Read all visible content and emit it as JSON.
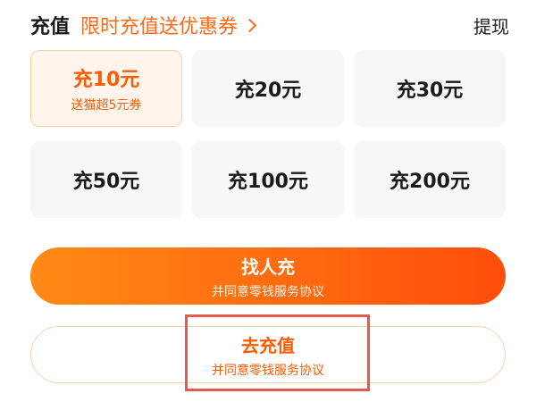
{
  "header": {
    "title": "充值",
    "promo_text": "限时充值送优惠券",
    "withdraw_label": "提现"
  },
  "amounts": [
    {
      "label": "充10元",
      "sub": "送猫超5元券",
      "selected": true
    },
    {
      "label": "充20元"
    },
    {
      "label": "充30元"
    },
    {
      "label": "充50元"
    },
    {
      "label": "充100元"
    },
    {
      "label": "充200元"
    }
  ],
  "actions": {
    "find_person": {
      "label": "找人充",
      "sub": "并同意零钱服务协议"
    },
    "recharge": {
      "label": "去充值",
      "sub": "并同意零钱服务协议"
    }
  },
  "colors": {
    "accent": "#ff6a1a",
    "highlight_outline": "#e45a4f"
  }
}
